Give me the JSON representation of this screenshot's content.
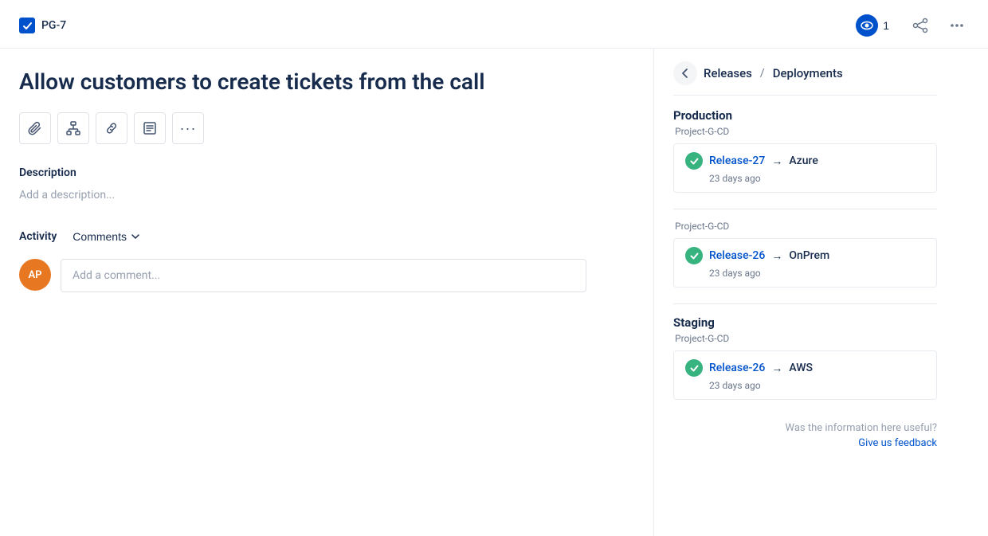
{
  "header": {
    "ticket_id": "PG-7",
    "watchers_count": "1",
    "watchers_label": "1"
  },
  "issue": {
    "title": "Allow customers to create tickets from the call",
    "description_label": "Description",
    "description_placeholder": "Add a description..."
  },
  "toolbar": {
    "buttons": [
      {
        "name": "attachment-icon",
        "symbol": "📎"
      },
      {
        "name": "hierarchy-icon",
        "symbol": "⊕"
      },
      {
        "name": "link-icon",
        "symbol": "🔗"
      },
      {
        "name": "notes-icon",
        "symbol": "📋"
      },
      {
        "name": "more-icon",
        "symbol": "···"
      }
    ]
  },
  "activity": {
    "label": "Activity",
    "filter_label": "Comments",
    "comment_placeholder": "Add a comment...",
    "user_initials": "AP"
  },
  "releases_panel": {
    "back_label": "Releases",
    "separator": "/",
    "section_label": "Deployments",
    "environments": [
      {
        "name": "Production",
        "project": "Project-G-CD",
        "deployments": [
          {
            "release": "Release-27",
            "arrow": "→",
            "target": "Azure",
            "time": "23 days ago"
          }
        ]
      },
      {
        "name": "",
        "project": "Project-G-CD",
        "deployments": [
          {
            "release": "Release-26",
            "arrow": "→",
            "target": "OnPrem",
            "time": "23 days ago"
          }
        ]
      },
      {
        "name": "Staging",
        "project": "Project-G-CD",
        "deployments": [
          {
            "release": "Release-26",
            "arrow": "→",
            "target": "AWS",
            "time": "23 days ago"
          }
        ]
      }
    ],
    "feedback_question": "Was the information here useful?",
    "feedback_link": "Give us feedback"
  }
}
